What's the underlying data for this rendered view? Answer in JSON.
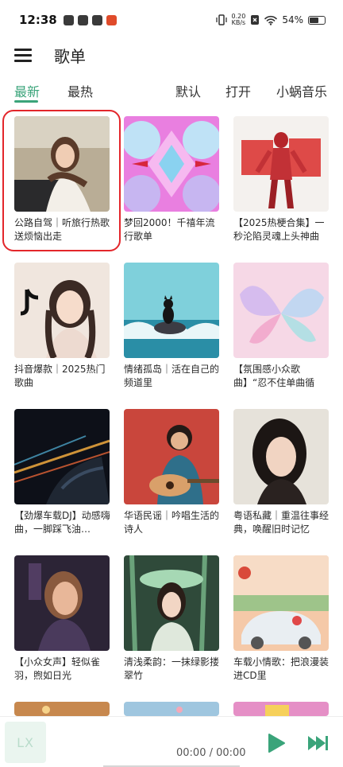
{
  "status": {
    "time": "12:38",
    "net_speed_value": "0.20",
    "net_speed_unit": "KB/s",
    "battery": "54%"
  },
  "header": {
    "title": "歌单"
  },
  "tabs": {
    "left": [
      {
        "label": "最新",
        "active": true
      },
      {
        "label": "最热",
        "active": false
      }
    ],
    "right": [
      {
        "label": "默认"
      },
      {
        "label": "打开"
      },
      {
        "label": "小蜗音乐"
      }
    ]
  },
  "accent_color": "#3aa47a",
  "playlists": [
    {
      "title": "公路自驾｜听旅行热歌送烦恼出走",
      "selected": true
    },
    {
      "title": "梦回2000！千禧年流行歌单"
    },
    {
      "title": "【2025热梗合集】一秒沦陷灵魂上头神曲"
    },
    {
      "title": "抖音爆款｜2025热门歌曲"
    },
    {
      "title": "情绪孤岛｜活在自己的频道里"
    },
    {
      "title": "【氛围感小众歌曲】“忍不住单曲循环！”"
    },
    {
      "title": "【劲爆车载DJ】动感嗨曲，一脚踩飞油…"
    },
    {
      "title": "华语民谣｜吟唱生活的诗人"
    },
    {
      "title": "粤语私藏｜重温往事经典，唤醒旧时记忆"
    },
    {
      "title": "【小众女声】轻似雀羽，煦如日光"
    },
    {
      "title": "清浅柔韵：一抹绿影搂翠竹"
    },
    {
      "title": "车载小情歌：把浪漫装进CD里"
    }
  ],
  "player": {
    "cover_text": "LX",
    "time": "00:00 / 00:00"
  }
}
